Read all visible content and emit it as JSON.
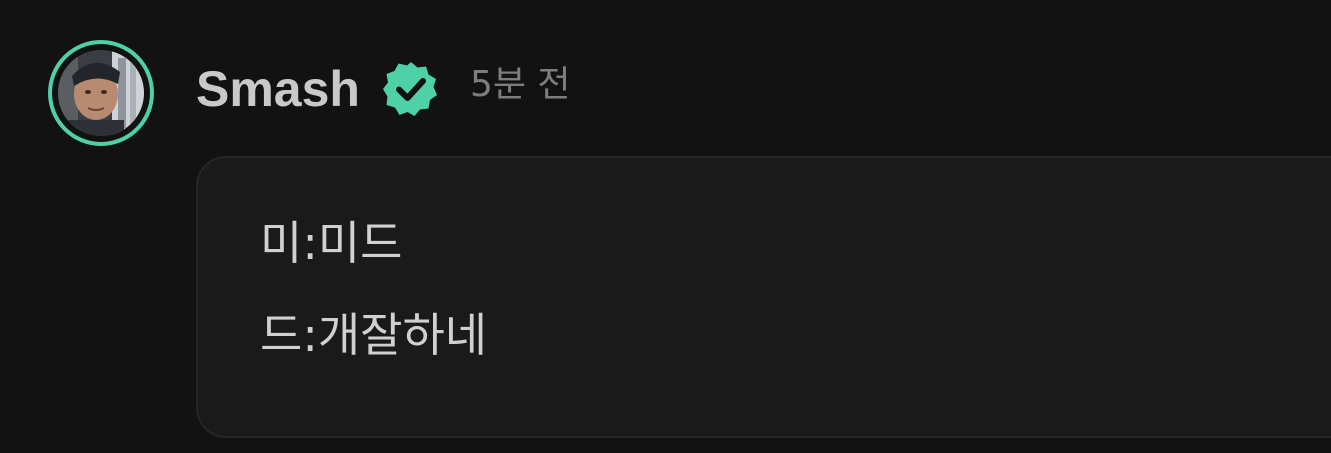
{
  "author": {
    "name": "Smash",
    "verified": true,
    "avatar_ring_color": "#4fd1a8"
  },
  "timestamp": "5분 전",
  "message": {
    "lines": [
      "미:미드",
      "드:개잘하네"
    ]
  },
  "icons": {
    "verified": "verified-badge-icon"
  },
  "colors": {
    "background": "#121212",
    "bubble": "#1a1a1a",
    "accent": "#4fd1a8",
    "name_text": "#c9c9c9",
    "time_text": "#7d7d7d",
    "message_text": "#d0d0d0"
  }
}
